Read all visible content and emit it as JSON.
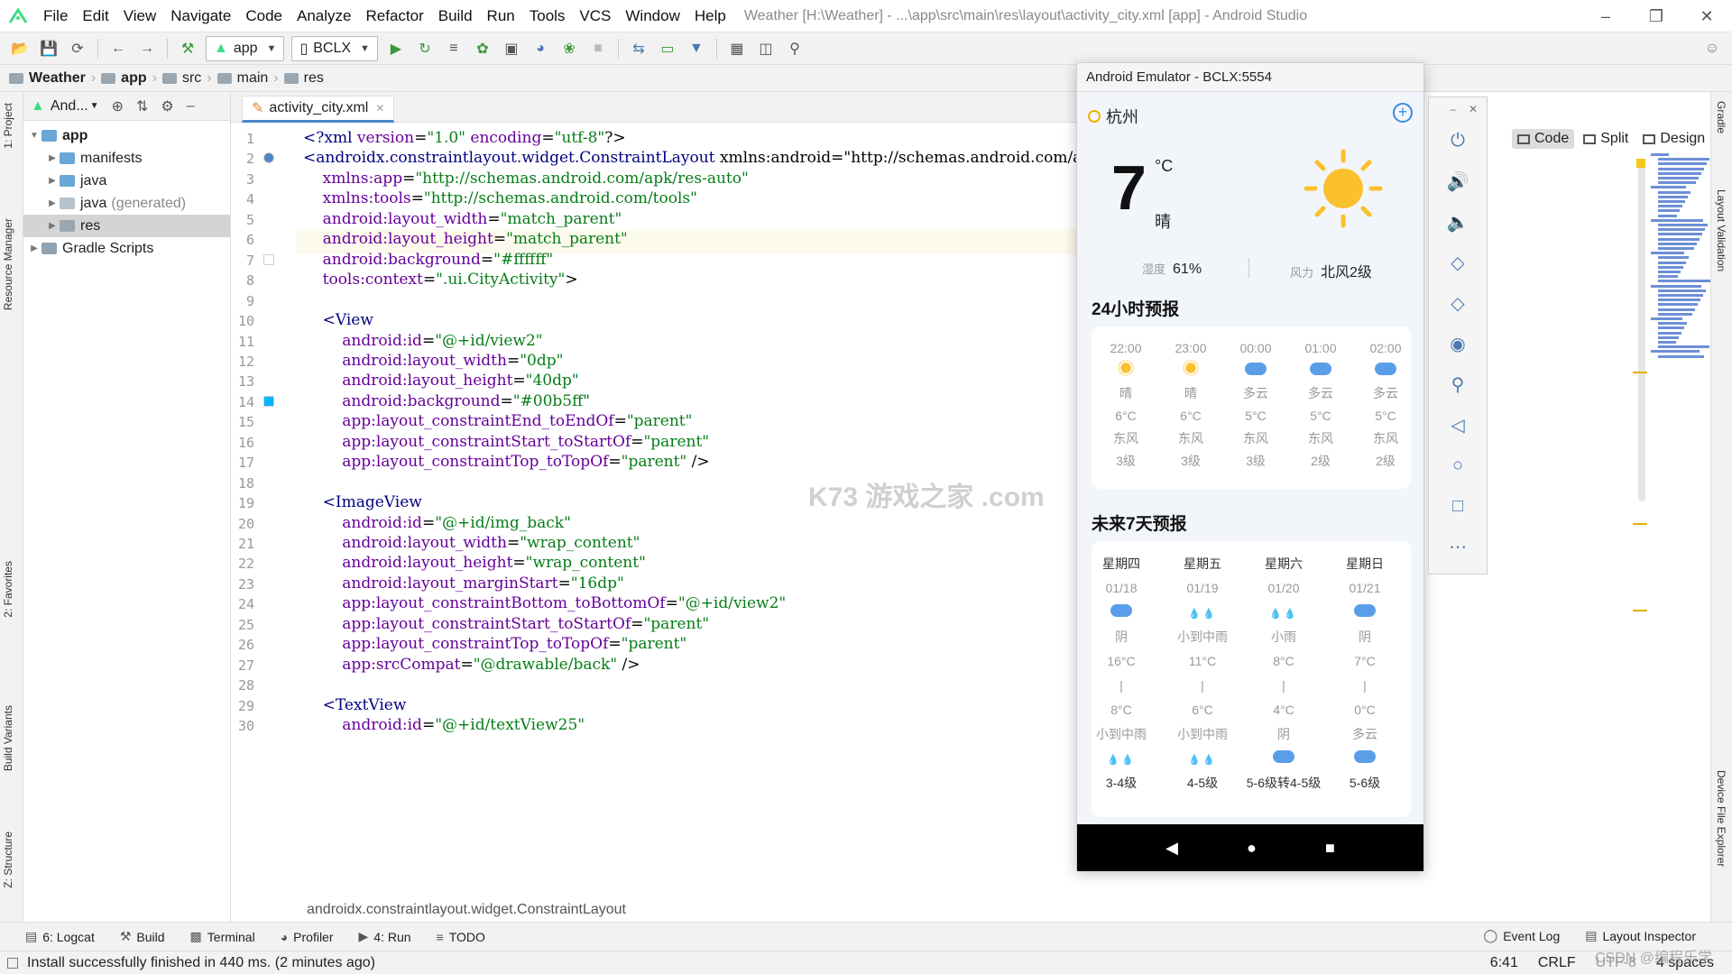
{
  "menu": {
    "items": [
      "File",
      "Edit",
      "View",
      "Navigate",
      "Code",
      "Analyze",
      "Refactor",
      "Build",
      "Run",
      "Tools",
      "VCS",
      "Window",
      "Help"
    ],
    "window_title": "Weather [H:\\Weather] - ...\\app\\src\\main\\res\\layout\\activity_city.xml [app] - Android Studio"
  },
  "toolbar": {
    "module_combo": "app",
    "device_combo": "BCLX"
  },
  "breadcrumb": [
    "Weather",
    "app",
    "src",
    "main",
    "res"
  ],
  "left_tools": [
    "1: Project",
    "Resource Manager",
    "2: Favorites",
    "Build Variants",
    "Z: Structure"
  ],
  "project_panel": {
    "view_label": "And...",
    "tree": [
      {
        "label": "app",
        "level": 0,
        "bold": true
      },
      {
        "label": "manifests",
        "level": 1
      },
      {
        "label": "java",
        "level": 1
      },
      {
        "label": "java",
        "suffix": "(generated)",
        "level": 1
      },
      {
        "label": "res",
        "level": 1,
        "selected": true
      },
      {
        "label": "Gradle Scripts",
        "level": 0
      }
    ]
  },
  "editor": {
    "tab_label": "activity_city.xml",
    "breadcrumb": "androidx.constraintlayout.widget.ConstraintLayout",
    "view_modes": [
      "Code",
      "Split",
      "Design"
    ],
    "lines": [
      "<?xml version=\"1.0\" encoding=\"utf-8\"?>",
      "<androidx.constraintlayout.widget.ConstraintLayout xmlns:android=\"http://schemas.android.com/ap",
      "    xmlns:app=\"http://schemas.android.com/apk/res-auto\"",
      "    xmlns:tools=\"http://schemas.android.com/tools\"",
      "    android:layout_width=\"match_parent\"",
      "    android:layout_height=\"match_parent\"",
      "    android:background=\"#ffffff\"",
      "    tools:context=\".ui.CityActivity\">",
      "",
      "    <View",
      "        android:id=\"@+id/view2\"",
      "        android:layout_width=\"0dp\"",
      "        android:layout_height=\"40dp\"",
      "        android:background=\"#00b5ff\"",
      "        app:layout_constraintEnd_toEndOf=\"parent\"",
      "        app:layout_constraintStart_toStartOf=\"parent\"",
      "        app:layout_constraintTop_toTopOf=\"parent\" />",
      "",
      "    <ImageView",
      "        android:id=\"@+id/img_back\"",
      "        android:layout_width=\"wrap_content\"",
      "        android:layout_height=\"wrap_content\"",
      "        android:layout_marginStart=\"16dp\"",
      "        app:layout_constraintBottom_toBottomOf=\"@+id/view2\"",
      "        app:layout_constraintStart_toStartOf=\"parent\"",
      "        app:layout_constraintTop_toTopOf=\"parent\"",
      "        app:srcCompat=\"@drawable/back\" />",
      "",
      "    <TextView",
      "        android:id=\"@+id/textView25\""
    ]
  },
  "right_tools": [
    "Gradle",
    "Layout Validation",
    "Device File Explorer"
  ],
  "bottom_tabs": [
    "6: Logcat",
    "Build",
    "Terminal",
    "Profiler",
    "4: Run",
    "TODO"
  ],
  "bottom_tabs_right": [
    "Event Log",
    "Layout Inspector"
  ],
  "status": {
    "message": "Install successfully finished in 440 ms. (2 minutes ago)",
    "position": "6:41",
    "line_sep": "CRLF",
    "encoding": "UTF-8",
    "indent": "4 spaces"
  },
  "emulator": {
    "title": "Android Emulator - BCLX:5554",
    "city": "杭州",
    "temp": "7",
    "unit": "°C",
    "condition": "晴",
    "humidity_label": "湿度",
    "humidity": "61%",
    "wind_label": "风力",
    "wind": "北风2级",
    "hourly_title": "24小时预报",
    "hourly": [
      {
        "time": "22:00",
        "icon": "sun",
        "cond": "晴",
        "temp": "6°C",
        "dir": "东风",
        "level": "3级"
      },
      {
        "time": "23:00",
        "icon": "sun",
        "cond": "晴",
        "temp": "6°C",
        "dir": "东风",
        "level": "3级"
      },
      {
        "time": "00:00",
        "icon": "cloud",
        "cond": "多云",
        "temp": "5°C",
        "dir": "东风",
        "level": "3级"
      },
      {
        "time": "01:00",
        "icon": "cloud",
        "cond": "多云",
        "temp": "5°C",
        "dir": "东风",
        "level": "2级"
      },
      {
        "time": "02:00",
        "icon": "cloud",
        "cond": "多云",
        "temp": "5°C",
        "dir": "东风",
        "level": "2级"
      }
    ],
    "weekly_title": "未来7天预报",
    "weekly": [
      {
        "day": "星期四",
        "date": "01/18",
        "icon": "cloud",
        "cond": "阴",
        "high": "16°C",
        "sep": "|",
        "low": "8°C",
        "night": "小到中雨",
        "night_icon": "rain",
        "wind": "3-4级"
      },
      {
        "day": "星期五",
        "date": "01/19",
        "icon": "rain",
        "cond": "小到中雨",
        "high": "11°C",
        "sep": "|",
        "low": "6°C",
        "night": "小到中雨",
        "night_icon": "rain",
        "wind": "4-5级"
      },
      {
        "day": "星期六",
        "date": "01/20",
        "icon": "rain",
        "cond": "小雨",
        "high": "8°C",
        "sep": "|",
        "low": "4°C",
        "night": "阴",
        "night_icon": "cloud",
        "wind": "5-6级转4-5级"
      },
      {
        "day": "星期日",
        "date": "01/21",
        "icon": "cloud",
        "cond": "阴",
        "high": "7°C",
        "sep": "|",
        "low": "0°C",
        "night": "多云",
        "night_icon": "cloud",
        "wind": "5-6级"
      }
    ]
  },
  "watermark": "K73 游戏之家 .com",
  "corner_watermark": "CSDN @编程乐学"
}
